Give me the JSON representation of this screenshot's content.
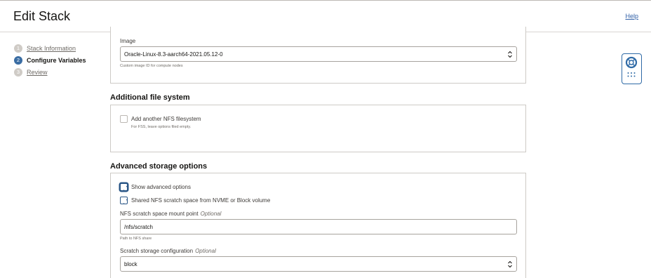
{
  "header": {
    "title": "Edit Stack",
    "help_label": "Help"
  },
  "steps": [
    {
      "num": "1",
      "label": "Stack Information"
    },
    {
      "num": "2",
      "label": "Configure Variables"
    },
    {
      "num": "3",
      "label": "Review"
    }
  ],
  "image_section": {
    "label": "Image",
    "value": "Oracle-Linux-8.3-aarch64-2021.05.12-0",
    "help": "Custom image ID for compute nodes"
  },
  "file_system": {
    "title": "Additional file system",
    "checkbox_label": "Add another NFS filesystem",
    "help": "For FSS, leave options filed empty."
  },
  "storage": {
    "title": "Advanced storage options",
    "show_advanced_label": "Show advanced options",
    "shared_nfs_label": "Shared NFS scratch space from NVME or Block volume",
    "mount_point_label": "NFS scratch space mount point",
    "optional": "Optional",
    "mount_point_value": "/nfs/scratch",
    "mount_point_help": "Path to NFS share",
    "config_label": "Scratch storage configuration",
    "config_value": "block"
  }
}
